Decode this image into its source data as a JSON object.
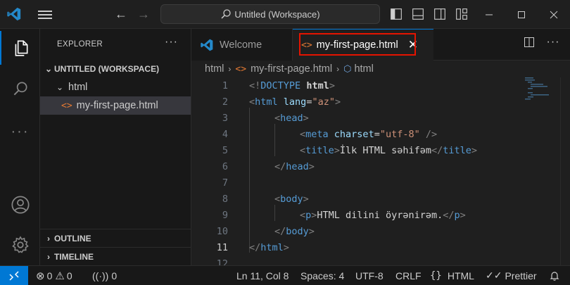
{
  "titlebar": {
    "search_label": "Untitled (Workspace)"
  },
  "sidebar": {
    "title": "EXPLORER",
    "more": "···",
    "workspace_label": "UNTITLED (WORKSPACE)",
    "folder_label": "html",
    "file_label": "my-first-page.html",
    "outline_label": "OUTLINE",
    "timeline_label": "TIMELINE"
  },
  "tabs": [
    {
      "label": "Welcome",
      "active": false
    },
    {
      "label": "my-first-page.html",
      "active": true
    }
  ],
  "breadcrumb": {
    "folder": "html",
    "file": "my-first-page.html",
    "symbol": "html"
  },
  "editor": {
    "current_line": 11,
    "line_numbers": [
      "1",
      "2",
      "3",
      "4",
      "5",
      "6",
      "7",
      "8",
      "9",
      "10",
      "11",
      "12"
    ],
    "lines": [
      {
        "indent": 0,
        "parts": [
          [
            "br",
            "<!"
          ],
          [
            "kw",
            "DOCTYPE"
          ],
          [
            "text",
            " "
          ],
          [
            "bold",
            "html"
          ],
          [
            "br",
            ">"
          ]
        ]
      },
      {
        "indent": 0,
        "parts": [
          [
            "br",
            "<"
          ],
          [
            "tag",
            "html"
          ],
          [
            "text",
            " "
          ],
          [
            "attr",
            "lang"
          ],
          [
            "text",
            "="
          ],
          [
            "str",
            "\"az\""
          ],
          [
            "br",
            ">"
          ]
        ]
      },
      {
        "indent": 1,
        "parts": [
          [
            "br",
            "<"
          ],
          [
            "tag",
            "head"
          ],
          [
            "br",
            ">"
          ]
        ]
      },
      {
        "indent": 2,
        "parts": [
          [
            "br",
            "<"
          ],
          [
            "tag",
            "meta"
          ],
          [
            "text",
            " "
          ],
          [
            "attr",
            "charset"
          ],
          [
            "text",
            "="
          ],
          [
            "str",
            "\"utf-8\""
          ],
          [
            "text",
            " "
          ],
          [
            "br",
            "/>"
          ]
        ]
      },
      {
        "indent": 2,
        "parts": [
          [
            "br",
            "<"
          ],
          [
            "tag",
            "title"
          ],
          [
            "br",
            ">"
          ],
          [
            "text",
            "İlk HTML səhifəm"
          ],
          [
            "br",
            "</"
          ],
          [
            "tag",
            "title"
          ],
          [
            "br",
            ">"
          ]
        ]
      },
      {
        "indent": 1,
        "parts": [
          [
            "br",
            "</"
          ],
          [
            "tag",
            "head"
          ],
          [
            "br",
            ">"
          ]
        ]
      },
      {
        "indent": 0,
        "parts": []
      },
      {
        "indent": 1,
        "parts": [
          [
            "br",
            "<"
          ],
          [
            "tag",
            "body"
          ],
          [
            "br",
            ">"
          ]
        ]
      },
      {
        "indent": 2,
        "parts": [
          [
            "br",
            "<"
          ],
          [
            "tag",
            "p"
          ],
          [
            "br",
            ">"
          ],
          [
            "text",
            "HTML dilini öyrənirəm."
          ],
          [
            "br",
            "</"
          ],
          [
            "tag",
            "p"
          ],
          [
            "br",
            ">"
          ]
        ]
      },
      {
        "indent": 1,
        "parts": [
          [
            "br",
            "</"
          ],
          [
            "tag",
            "body"
          ],
          [
            "br",
            ">"
          ]
        ]
      },
      {
        "indent": 0,
        "parts": [
          [
            "br",
            "</"
          ],
          [
            "tag",
            "html"
          ],
          [
            "br",
            ">"
          ]
        ]
      },
      {
        "indent": 0,
        "parts": []
      }
    ]
  },
  "statusbar": {
    "errors": "0",
    "warnings": "0",
    "ports": "0",
    "position": "Ln 11, Col 8",
    "spaces": "Spaces: 4",
    "encoding": "UTF-8",
    "eol": "CRLF",
    "language": "HTML",
    "prettier": "Prettier"
  },
  "colors": {
    "accent": "#0078d4",
    "highlight_box": "#e51400",
    "html_icon": "#e37933",
    "logo": "#2489ca"
  }
}
